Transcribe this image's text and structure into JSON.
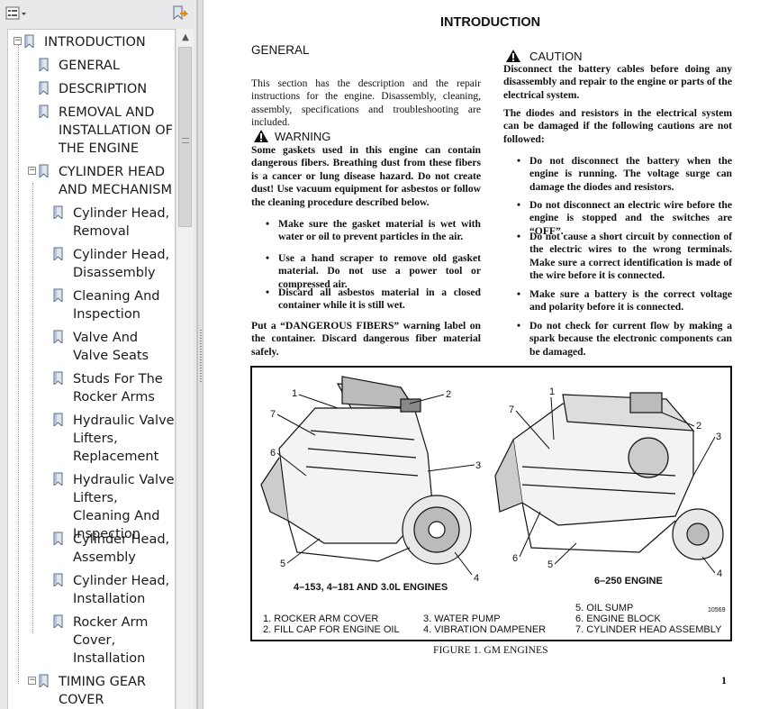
{
  "sidebar": {
    "toolbar": {
      "options_icon": "options-list-icon",
      "expand_icon": "bookmark-expand-icon"
    },
    "bookmarks": [
      {
        "label": "INTRODUCTION",
        "level": 0,
        "expanded": true
      },
      {
        "label": "GENERAL",
        "level": 1
      },
      {
        "label": "DESCRIPTION",
        "level": 1
      },
      {
        "label": "REMOVAL AND INSTALLATION OF THE ENGINE",
        "level": 1
      },
      {
        "label": "CYLINDER HEAD AND MECHANISM",
        "level": 1,
        "expanded": true
      },
      {
        "label": "Cylinder Head, Removal",
        "level": 2
      },
      {
        "label": "Cylinder Head, Disassembly",
        "level": 2
      },
      {
        "label": "Cleaning And Inspection",
        "level": 2
      },
      {
        "label": "Valve And Valve Seats",
        "level": 2
      },
      {
        "label": "Studs For The Rocker Arms",
        "level": 2
      },
      {
        "label": "Hydraulic Valve Lifters, Replacement",
        "level": 2
      },
      {
        "label": "Hydraulic Valve Lifters, Cleaning And Inspection",
        "level": 2
      },
      {
        "label": "Cylinder Head, Assembly",
        "level": 2
      },
      {
        "label": "Cylinder Head, Installation",
        "level": 2
      },
      {
        "label": "Rocker Arm Cover, Installation",
        "level": 2
      },
      {
        "label": "TIMING GEAR COVER",
        "level": 1,
        "expanded": true
      }
    ]
  },
  "page": {
    "title": "INTRODUCTION",
    "general_heading": "GENERAL",
    "general_text": "This section has the description and the repair instructions for the engine. Disassembly, cleaning, assembly, specifications and troubleshooting are included.",
    "warning": {
      "label": "WARNING",
      "text": "Some gaskets used in this engine can contain dangerous fibers. Breathing dust from these fibers is a cancer or lung disease hazard. Do not create dust! Use vacuum equipment for asbestos or follow the cleaning procedure described below.",
      "bullets": [
        "Make sure the gasket material is wet with water or oil to prevent particles in the air.",
        "Use a hand scraper to remove old gasket material. Do not use a power tool or compressed air.",
        "Discard all asbestos material in a closed container while it is still wet."
      ],
      "after": "Put a “DANGEROUS FIBERS” warning label on the container. Discard dangerous fiber material safely."
    },
    "caution": {
      "label": "CAUTION",
      "text1": "Disconnect the battery cables before doing any disassembly and repair to the engine or parts of the electrical system.",
      "text2": "The diodes and resistors in the electrical system can be damaged if the following cautions are not followed:",
      "bullets": [
        "Do not disconnect the battery when the engine is running. The voltage surge can damage the diodes and resistors.",
        "Do not disconnect an electric wire before the engine is stopped and the switches are “OFF”.",
        "Do not cause a short circuit by connection of the electric wires to the wrong terminals. Make sure a correct identification is made of the wire before it is connected.",
        "Make sure a battery is the correct voltage and polarity before it is connected.",
        "Do not check for current flow by making a spark because the electronic components can be damaged."
      ]
    },
    "figure": {
      "left_engine_label": "4–153, 4–181 AND 3.0L ENGINES",
      "right_engine_label": "6–250 ENGINE",
      "callouts": [
        "1",
        "2",
        "3",
        "4",
        "5",
        "6",
        "7"
      ],
      "legend": [
        "1. ROCKER ARM COVER",
        "2. FILL CAP FOR ENGINE OIL",
        "3. WATER PUMP",
        "4. VIBRATION DAMPENER",
        "5. OIL SUMP",
        "6. ENGINE BLOCK",
        "7. CYLINDER HEAD ASSEMBLY"
      ],
      "ref_number": "10569",
      "caption": "FIGURE 1. GM ENGINES"
    },
    "page_number": "1"
  }
}
